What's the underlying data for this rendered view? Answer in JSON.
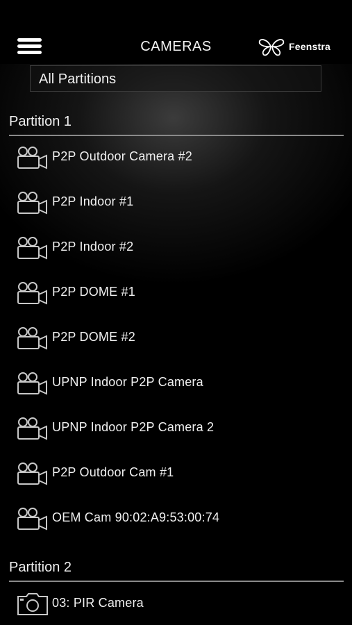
{
  "header": {
    "title": "CAMERAS",
    "logo_text": "Feenstra",
    "menu_icon": "hamburger-menu-icon"
  },
  "partition_filter": {
    "selected": "All Partitions"
  },
  "partitions": [
    {
      "name": "Partition 1",
      "cameras": [
        {
          "label": "P2P Outdoor Camera #2",
          "icon": "video-camera-icon"
        },
        {
          "label": "P2P Indoor #1",
          "icon": "video-camera-icon"
        },
        {
          "label": "P2P Indoor #2",
          "icon": "video-camera-icon"
        },
        {
          "label": "P2P DOME #1",
          "icon": "video-camera-icon"
        },
        {
          "label": "P2P DOME #2",
          "icon": "video-camera-icon"
        },
        {
          "label": "UPNP Indoor P2P Camera",
          "icon": "video-camera-icon"
        },
        {
          "label": "UPNP Indoor P2P Camera 2",
          "icon": "video-camera-icon"
        },
        {
          "label": "P2P Outdoor Cam #1",
          "icon": "video-camera-icon"
        },
        {
          "label": "OEM Cam 90:02:A9:53:00:74",
          "icon": "video-camera-icon"
        }
      ]
    },
    {
      "name": "Partition 2",
      "cameras": [
        {
          "label": "03: PIR Camera",
          "icon": "still-camera-icon"
        }
      ]
    }
  ],
  "colors": {
    "background": "#000000",
    "text": "#f0f0f0",
    "icon_stroke": "#c8c8c8",
    "divider": "#8a8a8a"
  }
}
